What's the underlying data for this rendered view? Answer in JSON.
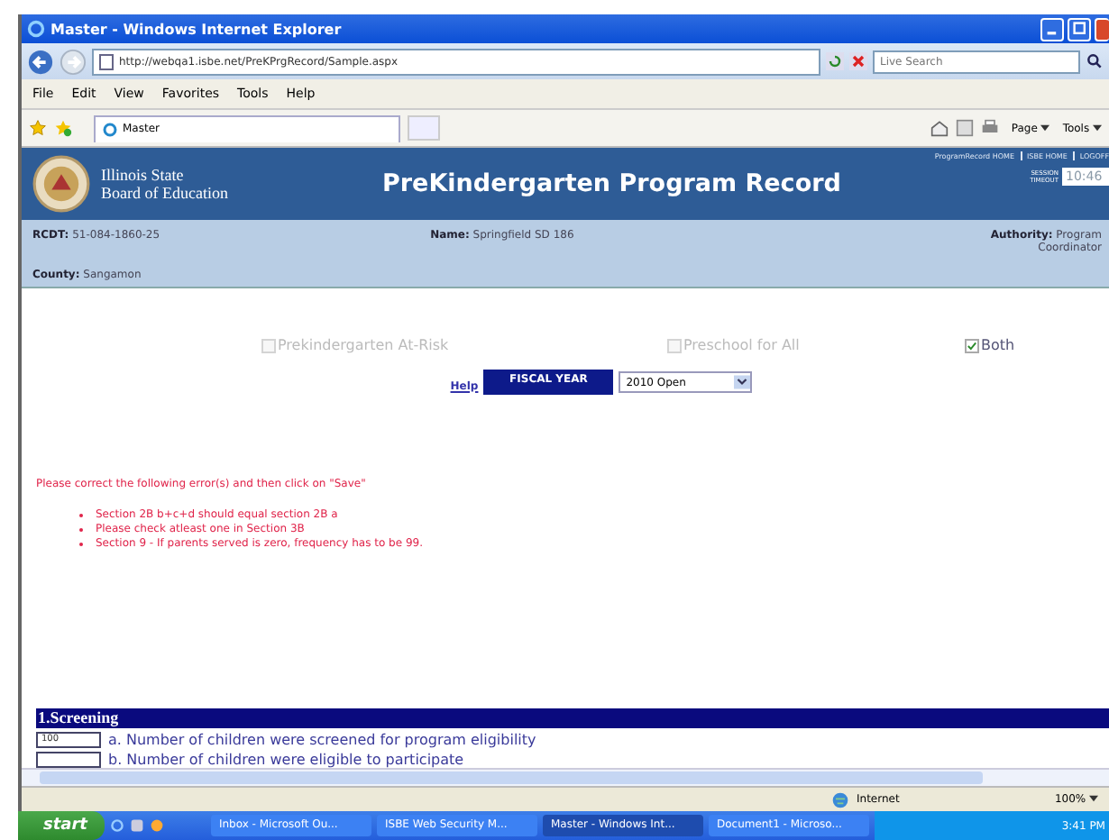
{
  "window": {
    "title": "Master - Windows Internet Explorer"
  },
  "address_bar": {
    "url": "http://webqa1.isbe.net/PreKPrgRecord/Sample.aspx",
    "search_placeholder": "Live Search"
  },
  "menu": [
    "File",
    "Edit",
    "View",
    "Favorites",
    "Tools",
    "Help"
  ],
  "browser_tab": {
    "label": "Master"
  },
  "command_bar": [
    "Page",
    "Tools"
  ],
  "header": {
    "agency_line_1": "Illinois State",
    "agency_line_2": "Board of Education",
    "title": "PreKindergarten Program Record",
    "links": [
      "ProgramRecord HOME",
      "ISBE HOME",
      "LOGOFF"
    ],
    "session_label_1": "SESSION",
    "session_label_2": "TIMEOUT",
    "session_value": "10:46"
  },
  "info": {
    "rcdt_label": "RCDT:",
    "rcdt": "51-084-1860-25",
    "name_label": "Name:",
    "name": "Springfield SD 186",
    "authority_label": "Authority:",
    "authority": "Program Coordinator",
    "county_label": "County:",
    "county": "Sangamon"
  },
  "program_types": [
    {
      "label": "Prekindergarten At-Risk",
      "checked": false,
      "disabled": true
    },
    {
      "label": "Preschool for All",
      "checked": false,
      "disabled": true
    },
    {
      "label": "Both",
      "checked": true,
      "disabled": false
    }
  ],
  "fiscal": {
    "help": "Help",
    "button": "FISCAL YEAR",
    "value": "2010 Open"
  },
  "errors": {
    "intro": "Please correct the following error(s) and then click on \"Save\"",
    "items": [
      "Section 2B b+c+d should equal section 2B a",
      "Please check atleast one in Section 3B",
      "Section 9 - If parents served is zero, frequency has to be 99."
    ]
  },
  "section": {
    "title": "1.Screening",
    "rows": [
      {
        "value": "100",
        "label": "a. Number of children were screened for program eligibility"
      },
      {
        "value": "",
        "label": "b. Number of children were eligible to participate"
      }
    ]
  },
  "status_bar": {
    "zone": "Internet",
    "zoom": "100%"
  },
  "taskbar": {
    "start": "start",
    "items": [
      {
        "label": "Inbox - Microsoft Ou...",
        "selected": false
      },
      {
        "label": "ISBE Web Security M...",
        "selected": false
      },
      {
        "label": "Master - Windows Int...",
        "selected": true
      },
      {
        "label": "Document1 - Microso...",
        "selected": false
      }
    ],
    "time": "3:41 PM"
  }
}
